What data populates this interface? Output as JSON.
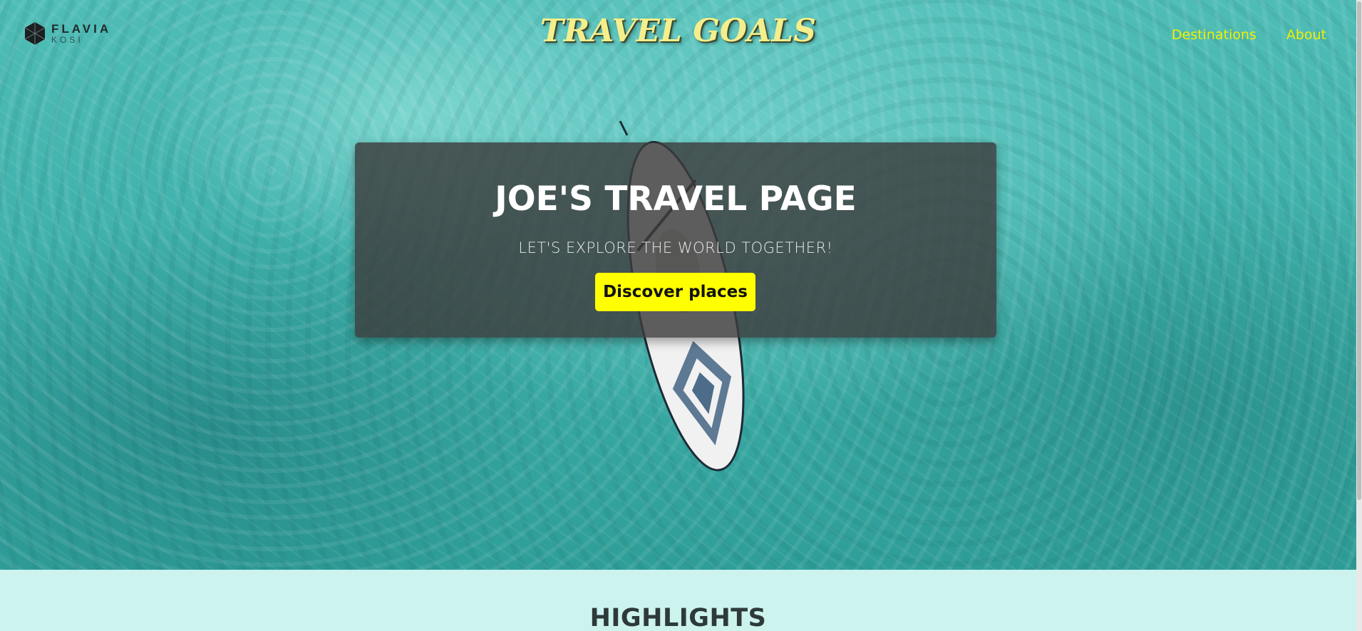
{
  "brand": {
    "logo_name": "FLAVIA",
    "logo_sub": "KOSI"
  },
  "header": {
    "site_title": "TRAVEL GOALS"
  },
  "nav": {
    "items": [
      {
        "label": "Destinations"
      },
      {
        "label": "About"
      }
    ]
  },
  "hero": {
    "heading": "JOE'S TRAVEL PAGE",
    "subheading": "LET'S EXPLORE THE WORLD TOGETHER!",
    "cta_label": "Discover places"
  },
  "highlights": {
    "title": "HIGHLIGHTS"
  },
  "colors": {
    "accent": "#ffff00",
    "nav_link": "#f2f000",
    "title": "#f4ef8c",
    "section_bg": "#cdf3ef"
  },
  "icons": {
    "logo": "hexagon-logo-icon"
  }
}
